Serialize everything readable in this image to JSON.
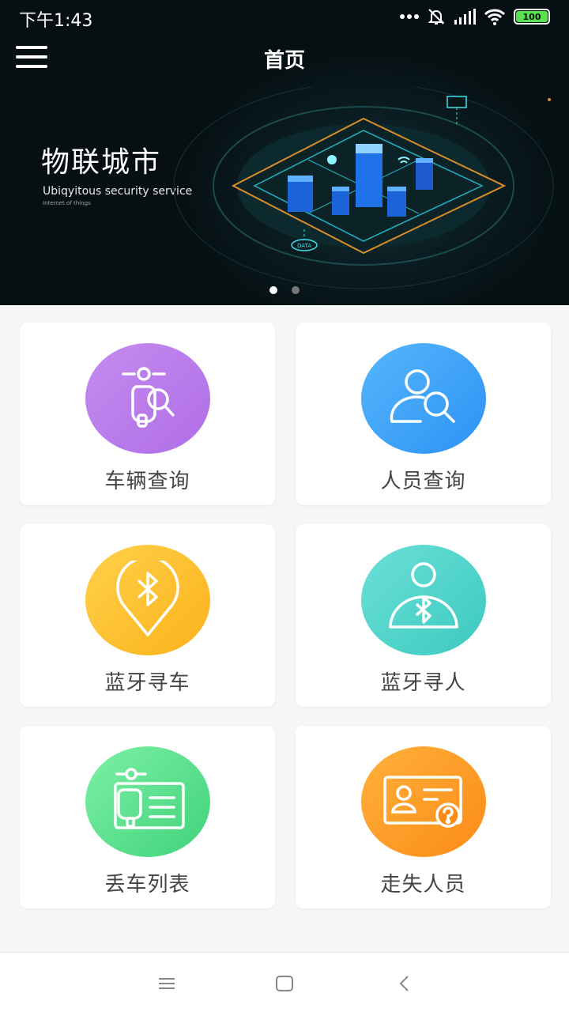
{
  "status_bar": {
    "time": "下午1:43",
    "battery": "100"
  },
  "header": {
    "title": "首页"
  },
  "banner": {
    "title": "物联城市",
    "subtitle": "Ubiqyitous security service",
    "tagline": "Internet of things",
    "art_label": "DATA",
    "page_count": 2,
    "active_page": 1
  },
  "menu": [
    {
      "label": "车辆查询",
      "icon": "scooter-search-icon",
      "color": "#b06de6"
    },
    {
      "label": "人员查询",
      "icon": "person-search-icon",
      "color": "#2d92f5"
    },
    {
      "label": "蓝牙寻车",
      "icon": "bluetooth-location-icon",
      "color": "#fbb21b"
    },
    {
      "label": "蓝牙寻人",
      "icon": "bluetooth-person-icon",
      "color": "#3cc9bf"
    },
    {
      "label": "丢车列表",
      "icon": "scooter-card-icon",
      "color": "#3fd27a"
    },
    {
      "label": "走失人员",
      "icon": "id-card-question-icon",
      "color": "#fb8b17"
    }
  ],
  "navbar": {
    "buttons": [
      "menu-icon",
      "home-square-icon",
      "back-chevron-icon"
    ]
  }
}
